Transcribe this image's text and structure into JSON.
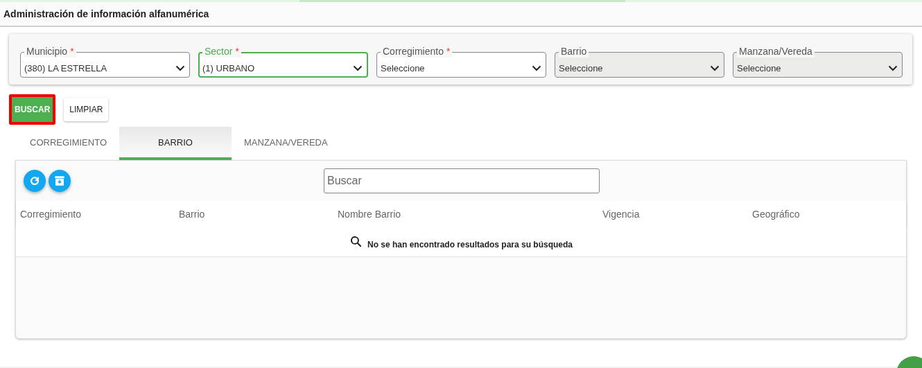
{
  "header": {
    "title": "Administración de información alfanumérica"
  },
  "filters": [
    {
      "label": "Municipio",
      "required": true,
      "value": "(380) LA ESTRELLA",
      "focused": false,
      "disabled": false
    },
    {
      "label": "Sector",
      "required": true,
      "value": "(1) URBANO",
      "focused": true,
      "disabled": false
    },
    {
      "label": "Corregimiento",
      "required": true,
      "value": "Seleccione",
      "focused": false,
      "disabled": false
    },
    {
      "label": "Barrio",
      "required": false,
      "value": "Seleccione",
      "focused": false,
      "disabled": true
    },
    {
      "label": "Manzana/Vereda",
      "required": false,
      "value": "Seleccione",
      "focused": false,
      "disabled": true
    }
  ],
  "required_mark": "*",
  "buttons": [
    {
      "label": "BUSCAR",
      "kind": "primary",
      "highlighted": true
    },
    {
      "label": "LIMPIAR",
      "kind": "secondary",
      "highlighted": false
    }
  ],
  "tabs": [
    {
      "label": "CORREGIMIENTO",
      "selected": false
    },
    {
      "label": "BARRIO",
      "selected": true
    },
    {
      "label": "MANZANA/VEREDA",
      "selected": false
    }
  ],
  "table": {
    "search": {
      "placeholder": "Buscar"
    },
    "columns": [
      "Corregimiento",
      "Barrio",
      "Nombre Barrio",
      "Vigencia",
      "Geográfico"
    ],
    "empty_message": "No se han encontrado resultados para su búsqueda"
  }
}
